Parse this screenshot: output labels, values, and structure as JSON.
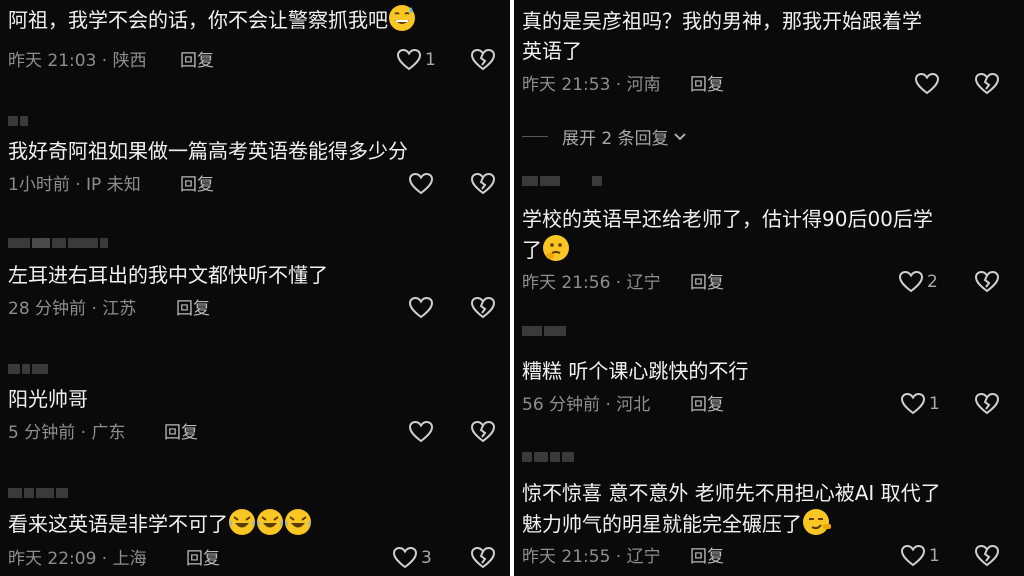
{
  "left": {
    "comments": [
      {
        "text": "阿祖，我学不会的话，你不会让警察抓我吧",
        "time": "昨天 21:03",
        "location": "陕西",
        "reply": "回复",
        "likes": "1"
      },
      {
        "text": "我好奇阿祖如果做一篇高考英语卷能得多少分",
        "time": "1小时前",
        "location": "IP 未知",
        "reply": "回复",
        "likes": ""
      },
      {
        "text": "左耳进右耳出的我中文都快听不懂了",
        "time": "28 分钟前",
        "location": "江苏",
        "reply": "回复",
        "likes": ""
      },
      {
        "text": "阳光帅哥",
        "time": "5 分钟前",
        "location": "广东",
        "reply": "回复",
        "likes": ""
      },
      {
        "text": "看来这英语是非学不可了",
        "time": "昨天 22:09",
        "location": "上海",
        "reply": "回复",
        "likes": "3"
      }
    ]
  },
  "right": {
    "comments": [
      {
        "text_line1": "真的是吴彦祖吗？我的男神，那我开始跟着学",
        "text_line2": "英语了",
        "time": "昨天 21:53",
        "location": "河南",
        "reply": "回复",
        "likes": ""
      },
      {
        "text_line1": "学校的英语早还给老师了，估计得90后00后学",
        "text_line2": "了",
        "time": "昨天 21:56",
        "location": "辽宁",
        "reply": "回复",
        "likes": "2"
      },
      {
        "text_line1": "糟糕  听个课心跳快的不行",
        "time": "56 分钟前",
        "location": "河北",
        "reply": "回复",
        "likes": "1"
      },
      {
        "text_line1": "惊不惊喜  意不意外  老师先不用担心被AI 取代了",
        "text_line2": "魅力帅气的明星就能完全碾压了",
        "time": "昨天 21:55",
        "location": "辽宁",
        "reply": "回复",
        "likes": "1"
      }
    ],
    "expand_label": "展开 2 条回复"
  },
  "meta_separator": " · ",
  "icons": {
    "like": "heart-outline-icon",
    "dislike": "broken-heart-icon",
    "expand": "chevron-down-icon"
  },
  "colors": {
    "background": "#0a0a0a",
    "text": "#f1f1f1",
    "meta": "#8e8e8e"
  }
}
